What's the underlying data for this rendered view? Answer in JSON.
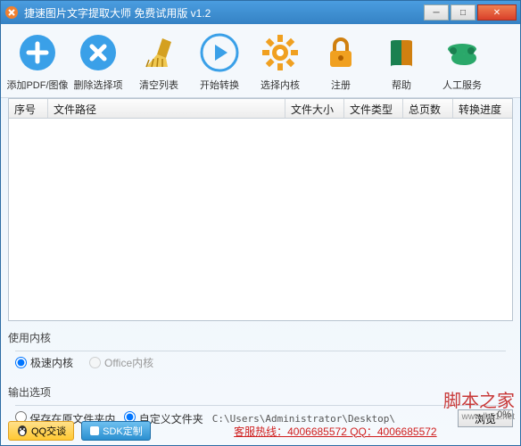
{
  "window": {
    "title": "捷速图片文字提取大师 免费试用版 v1.2"
  },
  "toolbar": [
    {
      "id": "add",
      "label": "添加PDF/图像",
      "icon": "plus"
    },
    {
      "id": "remove",
      "label": "删除选择项",
      "icon": "cross"
    },
    {
      "id": "clear",
      "label": "清空列表",
      "icon": "broom"
    },
    {
      "id": "start",
      "label": "开始转换",
      "icon": "play"
    },
    {
      "id": "engine",
      "label": "选择内核",
      "icon": "gear"
    },
    {
      "id": "register",
      "label": "注册",
      "icon": "lock"
    },
    {
      "id": "help",
      "label": "帮助",
      "icon": "book"
    },
    {
      "id": "service",
      "label": "人工服务",
      "icon": "phone"
    }
  ],
  "table": {
    "headers": {
      "c1": "序号",
      "c2": "文件路径",
      "c3": "文件大小",
      "c4": "文件类型",
      "c5": "总页数",
      "c6": "转换进度"
    },
    "rows": []
  },
  "engine_panel": {
    "label": "使用内核",
    "opt_fast": "极速内核",
    "opt_office": "Office内核"
  },
  "output_panel": {
    "label": "输出选项",
    "opt_same": "保存在原文件夹内",
    "opt_custom": "自定义文件夹",
    "path": "C:\\Users\\Administrator\\Desktop\\",
    "browse": "浏览"
  },
  "footer": {
    "qq": "QQ交谈",
    "sdk": "SDK定制",
    "hotline": "客服热线：4006685572 QQ：4006685572",
    "percent": "0%"
  },
  "watermark": {
    "text": "脚本之家",
    "url": "www.jb51.net"
  }
}
